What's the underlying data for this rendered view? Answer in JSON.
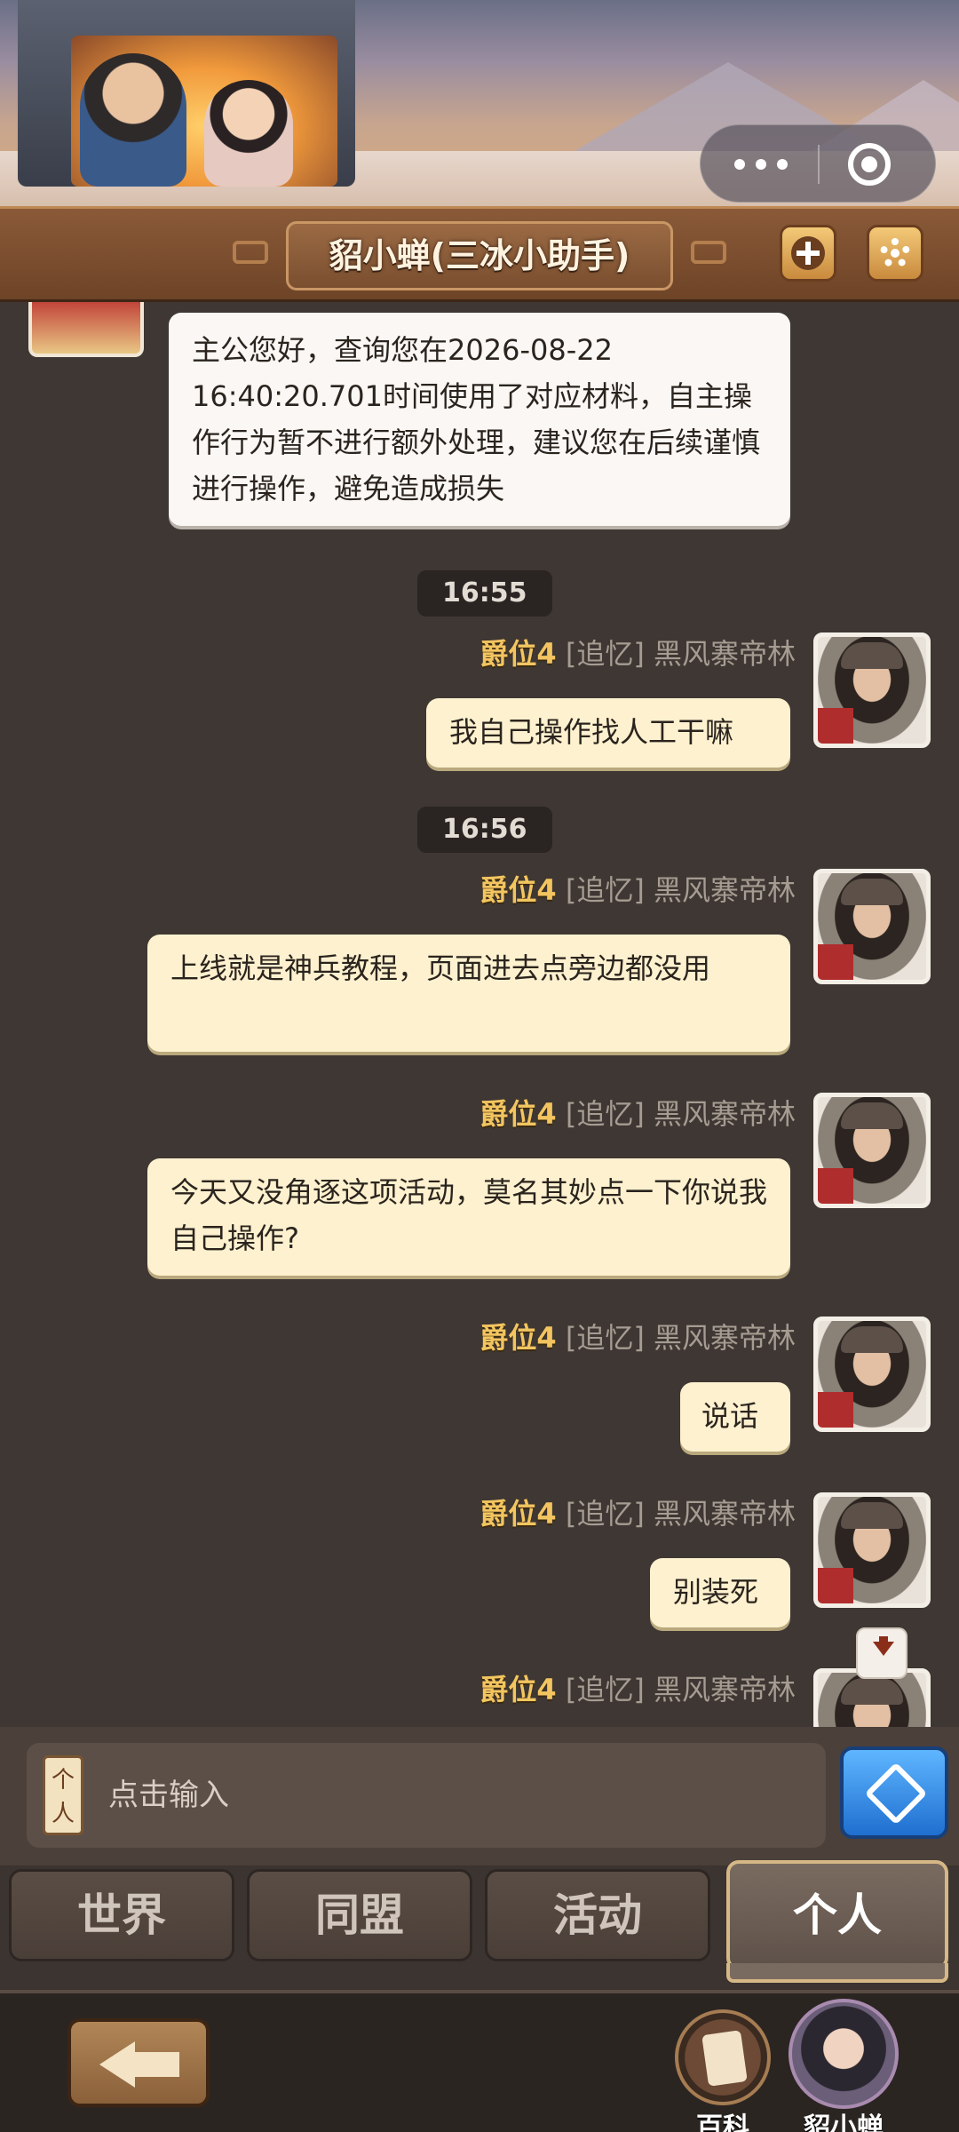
{
  "header": {
    "title": "貂小蝉(三冰小助手)",
    "more_icon": "more-dots-icon",
    "close_icon": "target-ring-icon",
    "add_icon": "plus-icon",
    "settings_icon": "gear-icon"
  },
  "chat": {
    "bot_message": "主公您好，查询您在2026-08-22 16:40:20.701时间使用了对应材料，自主操作行为暂不进行额外处理，建议您在后续谨慎进行操作，避免造成损失",
    "timestamps": [
      "16:55",
      "16:56"
    ],
    "sender": {
      "rank": "爵位4",
      "tag": "[追忆]",
      "name": "黑风寨帝林"
    },
    "messages": [
      "我自己操作找人工干嘛",
      "上线就是神兵教程，页面进去点旁边都没用",
      "今天又没角逐这项活动，莫名其妙点一下你说我自己操作?",
      "说话",
      "别装死"
    ]
  },
  "input": {
    "tag": "个人",
    "placeholder": "点击输入",
    "send_icon": "send-arrow-icon"
  },
  "tabs": [
    {
      "label": "世界"
    },
    {
      "label": "同盟"
    },
    {
      "label": "活动"
    },
    {
      "label": "个人",
      "active": true
    }
  ],
  "bottom": {
    "back_icon": "exit-arrow-icon",
    "wiki_label": "百科",
    "assistant_label": "貂小蝉"
  },
  "colors": {
    "rank": "#f3c560",
    "bubble_me": "#fdf1cf",
    "bubble_bot": "#faf7f4",
    "send_button": "#1f6fd0"
  }
}
